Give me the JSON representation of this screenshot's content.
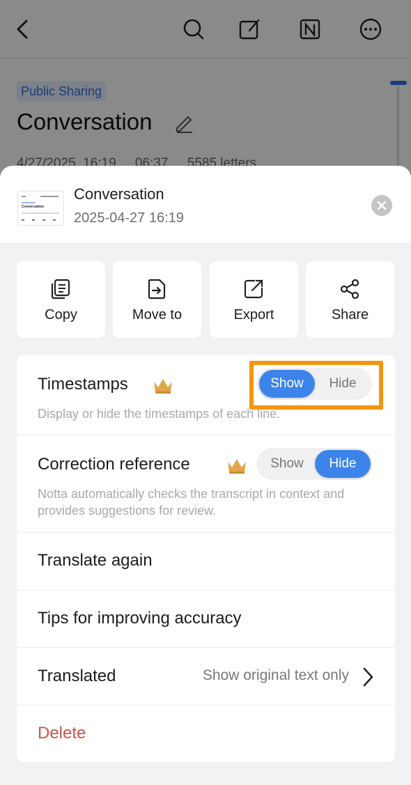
{
  "background": {
    "tag": "Public Sharing",
    "title": "Conversation",
    "meta": {
      "date": "4/27/2025, 16:19",
      "duration": "06:37",
      "letters": "5585 letters"
    }
  },
  "sheet": {
    "title": "Conversation",
    "date": "2025-04-27 16:19",
    "thumbnail_title": "Conversation",
    "actions": [
      {
        "label": "Copy",
        "icon": "copy-icon"
      },
      {
        "label": "Move to",
        "icon": "move-to-icon"
      },
      {
        "label": "Export",
        "icon": "export-icon"
      },
      {
        "label": "Share",
        "icon": "share-icon"
      }
    ],
    "timestamps": {
      "title": "Timestamps",
      "description": "Display or hide the timestamps of each line.",
      "show": "Show",
      "hide": "Hide",
      "selected": "Show"
    },
    "correction": {
      "title": "Correction reference",
      "description": "Notta automatically checks the transcript in context and provides suggestions for review.",
      "show": "Show",
      "hide": "Hide",
      "selected": "Hide"
    },
    "translate_again": "Translate again",
    "tips": "Tips for improving accuracy",
    "translated": {
      "title": "Translated",
      "value": "Show original text only"
    },
    "delete": "Delete"
  },
  "colors": {
    "accent": "#3d84ea",
    "highlight": "#f5950f",
    "delete": "#c9554a",
    "crown": "#e0a64a"
  }
}
